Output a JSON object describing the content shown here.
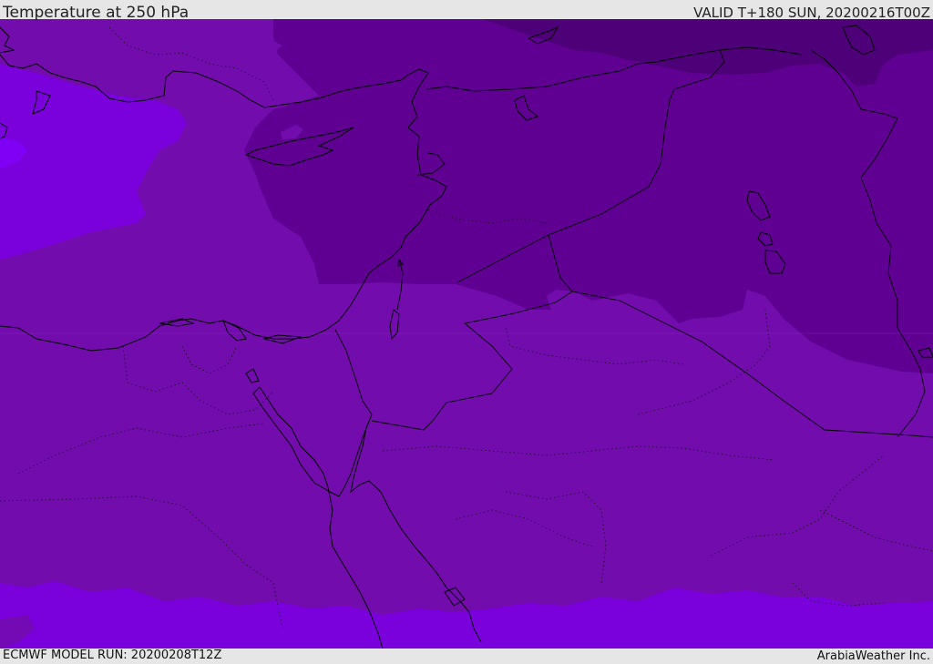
{
  "header": {
    "title": "Temperature at 250 hPa",
    "valid_time": "VALID T+180 SUN, 20200216T00Z"
  },
  "footer": {
    "model_run": "ECMWF MODEL RUN: 20200208T12Z",
    "provider": "ArabiaWeather Inc."
  },
  "map": {
    "field": "temperature",
    "level": "250 hPa",
    "colors": {
      "darkest": "#4e0078",
      "dark": "#5f0093",
      "mid": "#720cad",
      "light": "#7a00dc",
      "lightest": "#8000f5",
      "boundary": "#000000",
      "header_bg": "#e6e6e6"
    }
  }
}
